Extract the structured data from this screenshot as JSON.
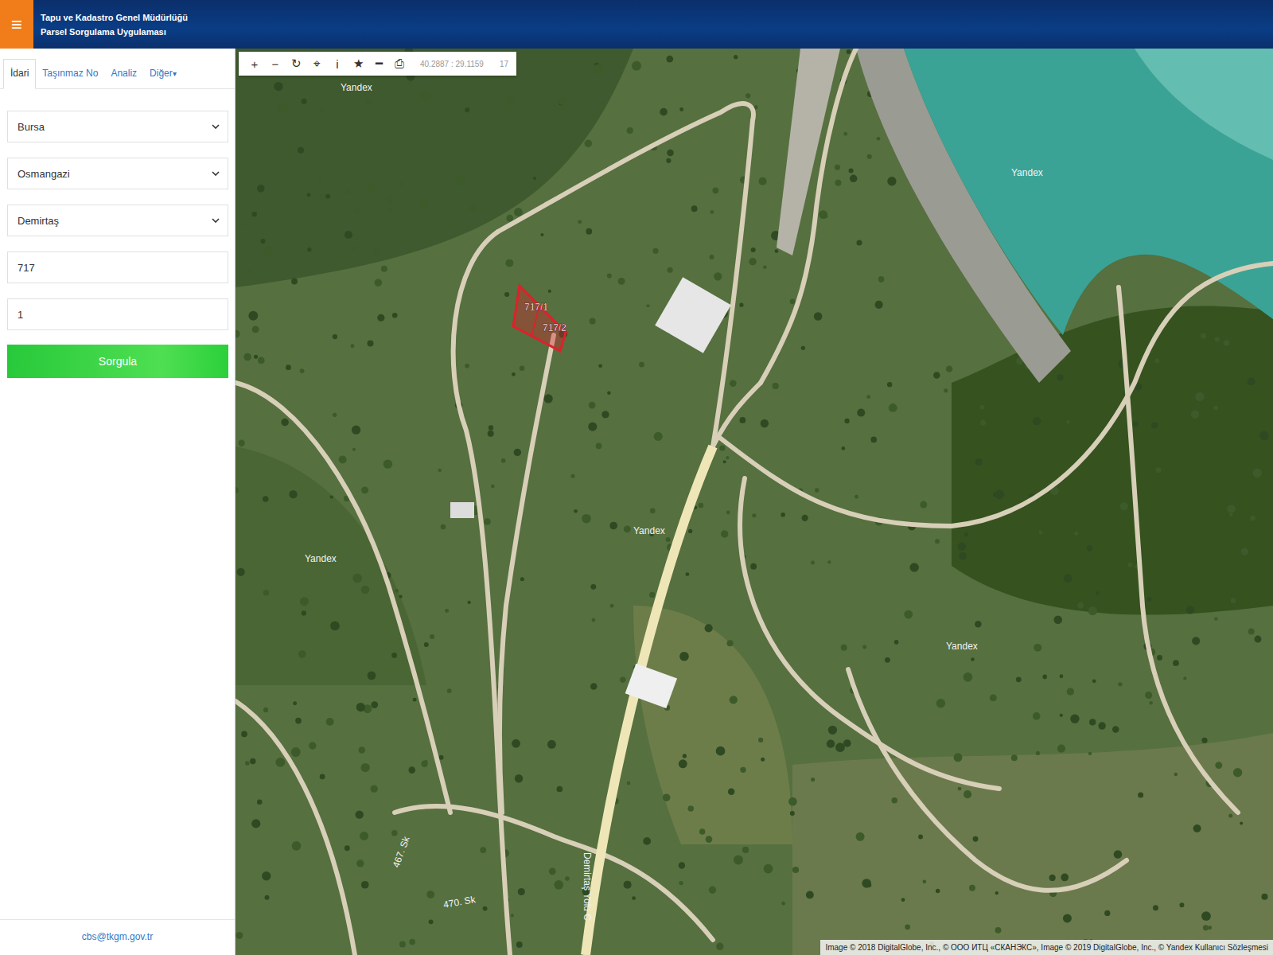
{
  "header": {
    "menu_icon": "≡",
    "title": "Tapu ve Kadastro Genel Müdürlüğü",
    "subtitle": "Parsel Sorgulama Uygulaması"
  },
  "tabs": [
    {
      "label": "İdari",
      "selected": true,
      "caret": ""
    },
    {
      "label": "Taşınmaz No",
      "selected": false,
      "caret": ""
    },
    {
      "label": "Analiz",
      "selected": false,
      "caret": ""
    },
    {
      "label": "Diğer",
      "selected": false,
      "caret": "▾"
    }
  ],
  "fields": [
    {
      "kind": "select",
      "value": "Bursa"
    },
    {
      "kind": "select",
      "value": "Osmangazi"
    },
    {
      "kind": "select",
      "value": "Demirtaş"
    },
    {
      "kind": "input",
      "value": "717"
    },
    {
      "kind": "input",
      "value": "1"
    }
  ],
  "query_button": "Sorgula",
  "footer": "cbs@tkgm.gov.tr",
  "toolbar": {
    "tools": [
      "+",
      "−",
      "↻",
      "⌖",
      "i",
      "★",
      "━",
      "⎙"
    ],
    "coordinates": "40.2887 : 29.1159",
    "zoom": "17"
  },
  "parcels": [
    {
      "label": "717/1"
    },
    {
      "label": "717/2"
    }
  ],
  "map_labels": [
    "Yandex",
    "Yandex",
    "Yandex",
    "Yandex",
    "Yandex",
    "Demirtaş Yolu C",
    "467. Sk",
    "470. Sk"
  ],
  "attribution": "Image © 2018 DigitalGlobe, Inc., © ООО ИТЦ «СКАНЭКС», Image © 2019 DigitalGlobe, Inc., © Yandex Kullanıcı Sözleşmesi"
}
